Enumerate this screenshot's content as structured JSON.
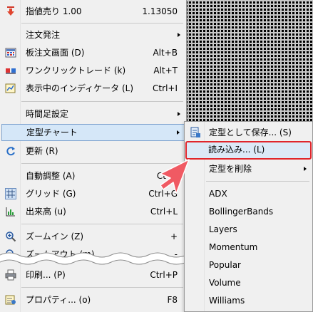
{
  "main_menu": {
    "items": [
      {
        "label": "指値売り 1.00",
        "shortcut": "1.13050",
        "icon": "sell-arrow-icon"
      },
      {
        "label": "注文発注",
        "shortcut": "",
        "icon": ""
      },
      {
        "label": "板注文画面 (D)",
        "shortcut": "Alt+B",
        "icon": "order-board-icon"
      },
      {
        "label": "ワンクリックトレード (k)",
        "shortcut": "Alt+T",
        "icon": "one-click-trade-icon"
      },
      {
        "label": "表示中のインディケータ (L)",
        "shortcut": "Ctrl+I",
        "icon": "indicator-icon"
      },
      {
        "label": "時間足設定",
        "shortcut": "",
        "icon": ""
      },
      {
        "label": "定型チャート",
        "shortcut": "",
        "icon": ""
      },
      {
        "label": "更新 (R)",
        "shortcut": "",
        "icon": "refresh-icon"
      },
      {
        "label": "自動調整 (A)",
        "shortcut": "Ct",
        "icon": ""
      },
      {
        "label": "グリッド (G)",
        "shortcut": "Ctrl+G",
        "icon": "grid-icon"
      },
      {
        "label": "出来高 (u)",
        "shortcut": "Ctrl+L",
        "icon": "volume-icon"
      },
      {
        "label": "ズームイン (Z)",
        "shortcut": "+",
        "icon": "zoom-in-icon"
      },
      {
        "label": "ズームアウト (m)",
        "shortcut": "-",
        "icon": "zoom-out-icon"
      },
      {
        "label": "印刷... (P)",
        "shortcut": "Ctrl+P",
        "icon": "print-icon"
      },
      {
        "label": "プロパティ... (o)",
        "shortcut": "F8",
        "icon": "properties-icon"
      }
    ]
  },
  "sub_menu": {
    "items": [
      {
        "label": "定型として保存... (S)"
      },
      {
        "label": "読み込み... (L)"
      },
      {
        "label": "定型を削除"
      },
      {
        "label": "ADX"
      },
      {
        "label": "BollingerBands"
      },
      {
        "label": "Layers"
      },
      {
        "label": "Momentum"
      },
      {
        "label": "Popular"
      },
      {
        "label": "Volume"
      },
      {
        "label": "Williams"
      }
    ]
  },
  "colors": {
    "highlight": "#d5e7f8",
    "focus_border": "#e0252b",
    "pointer": "#f05a63"
  }
}
